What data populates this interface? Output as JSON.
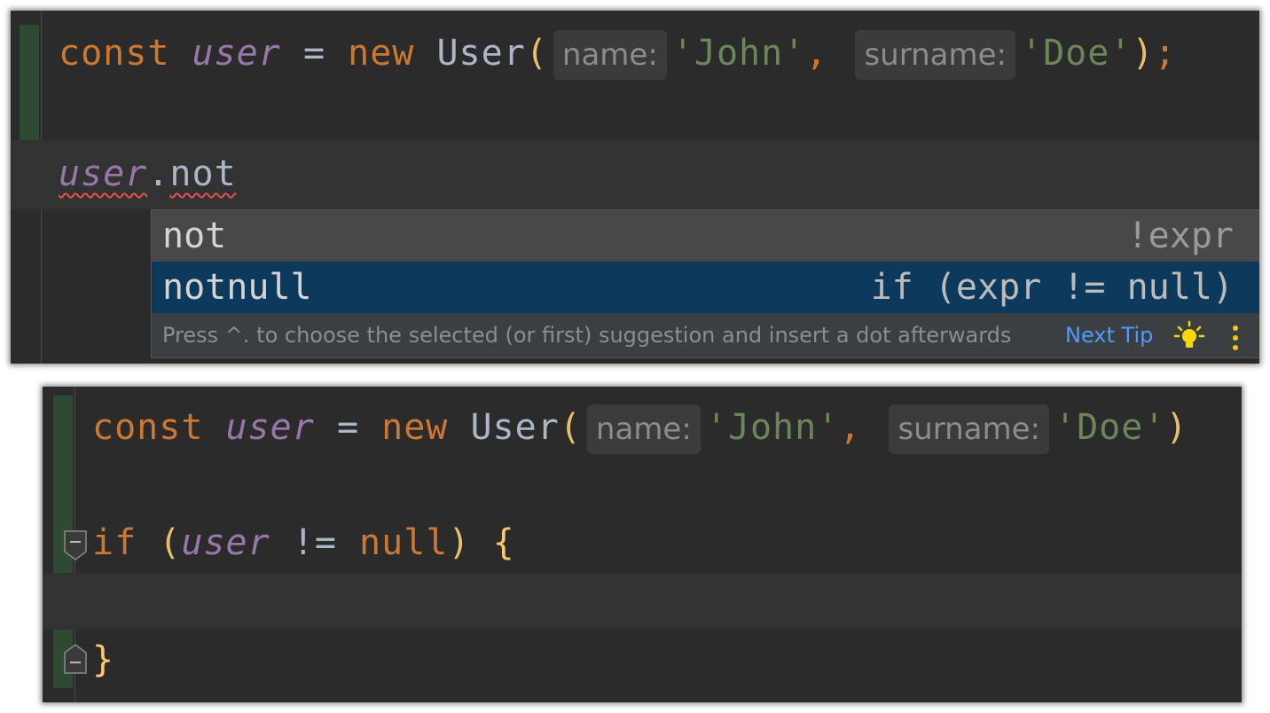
{
  "top": {
    "code": {
      "const_kw": "const",
      "var": "user",
      "eq": "=",
      "new_kw": "new",
      "class_name": "User",
      "open_paren": "(",
      "hint_name": "name:",
      "arg_name": "'John'",
      "comma": ",",
      "hint_surname": "surname:",
      "arg_surname": "'Doe'",
      "close_paren": ")",
      "semicolon": ";"
    },
    "typed": {
      "var": "user",
      "dot": ".",
      "member": "not"
    },
    "popup": {
      "items": [
        {
          "name": "not",
          "tail": "!expr"
        },
        {
          "name": "notnull",
          "tail": "if (expr != null)"
        }
      ],
      "footer_text": "Press ^. to choose the selected (or first) suggestion and insert a dot afterwards",
      "next_tip": "Next Tip",
      "bulb_icon": "lightbulb-icon",
      "more_icon": "more-vertical-icon"
    }
  },
  "bottom": {
    "code": {
      "const_kw": "const",
      "var": "user",
      "eq": "=",
      "new_kw": "new",
      "class_name": "User",
      "open_paren": "(",
      "hint_name": "name:",
      "arg_name": "'John'",
      "comma": ",",
      "hint_surname": "surname:",
      "arg_surname": "'Doe'",
      "close_paren": ")"
    },
    "if_line": {
      "if_kw": "if",
      "open_paren": "(",
      "var": "user",
      "op": "!=",
      "null_kw": "null",
      "close_paren": ")",
      "open_brace": "{"
    },
    "close_brace": "}"
  },
  "colors": {
    "editor_bg": "#2b2b2b",
    "keyword": "#cc7832",
    "variable": "#9876aa",
    "string": "#6a8759",
    "selection": "#0d3a5c",
    "link": "#4a9df8",
    "bulb": "#f5d90a"
  }
}
